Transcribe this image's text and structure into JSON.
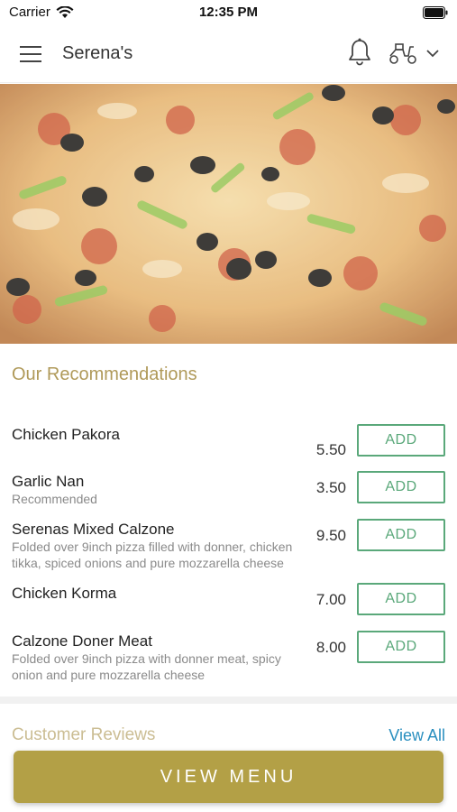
{
  "status_bar": {
    "carrier": "Carrier",
    "time": "12:35 PM"
  },
  "header": {
    "title": "Serena's"
  },
  "recommendations": {
    "title": "Our Recommendations",
    "add_label": "ADD",
    "items": [
      {
        "name": "Chicken Pakora",
        "description": "",
        "price": "5.50"
      },
      {
        "name": "Garlic Nan",
        "description": "Recommended",
        "price": "3.50"
      },
      {
        "name": "Serenas Mixed Calzone",
        "description": "Folded over 9inch pizza filled with donner, chicken tikka, spiced onions and pure mozzarella cheese",
        "price": "9.50"
      },
      {
        "name": "Chicken Korma",
        "description": "",
        "price": "7.00"
      },
      {
        "name": "Calzone Doner Meat",
        "description": "Folded over 9inch pizza with donner meat, spicy onion and pure mozzarella cheese",
        "price": "8.00"
      }
    ]
  },
  "reviews": {
    "title": "Customer Reviews",
    "view_all": "View All"
  },
  "footer": {
    "view_menu": "VIEW MENU"
  },
  "colors": {
    "accent": "#b3a046",
    "section_title": "#b09a5a",
    "add_button": "#5aa87a",
    "link": "#2a8fbf"
  },
  "icons": [
    "wifi-icon",
    "battery-icon",
    "hamburger-menu-icon",
    "bell-icon",
    "delivery-scooter-icon",
    "chevron-down-icon"
  ]
}
